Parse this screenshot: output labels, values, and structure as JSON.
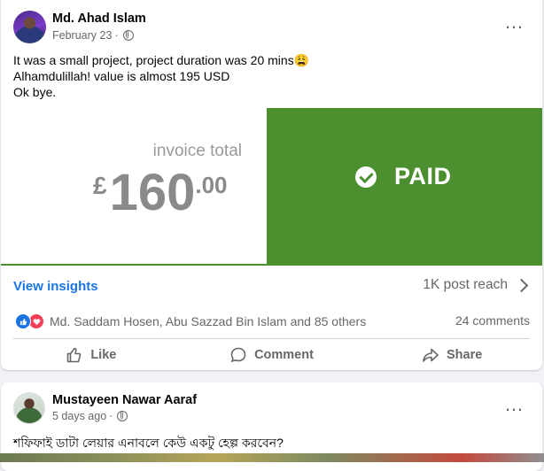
{
  "post1": {
    "author": "Md. Ahad Islam",
    "date": "February 23",
    "separator": "·",
    "more_icon": "…",
    "text_lines": [
      "It was a small project, project duration was 20 mins😩",
      "Alhamdulillah! value is almost 195 USD",
      "Ok bye."
    ],
    "invoice": {
      "label": "invoice total",
      "currency": "£",
      "amount_main": "160",
      "amount_cents": ".00",
      "status": "PAID",
      "accent": "#4c8f2f"
    },
    "insights_label": "View insights",
    "reach": "1K post reach",
    "reactions_text": "Md. Saddam Hosen, Abu Sazzad Bin Islam and 85 others",
    "comments": "24 comments",
    "actions": {
      "like": "Like",
      "comment": "Comment",
      "share": "Share"
    }
  },
  "post2": {
    "author": "Mustayeen Nawar Aaraf",
    "date": "5 days ago",
    "separator": "·",
    "more_icon": "…",
    "text": "শফিফাই ডাটা লেয়ার এনাবলে কেউ একটু হেল্প করবেন?"
  },
  "colors": {
    "link": "#1b74e4",
    "muted": "#65676b",
    "background": "#f0f2f5"
  }
}
